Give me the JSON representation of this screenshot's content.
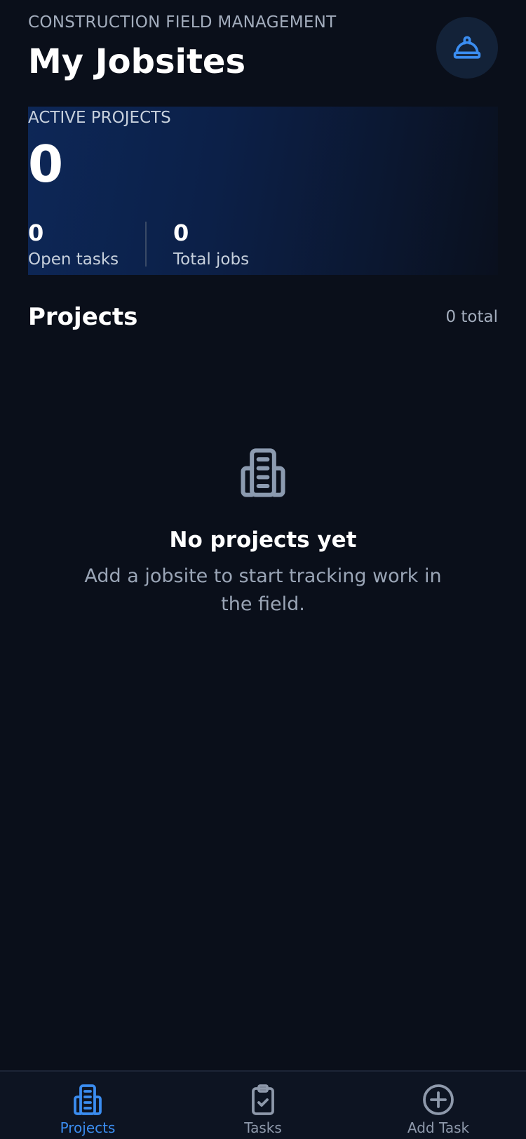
{
  "header": {
    "eyebrow": "CONSTRUCTION FIELD MANAGEMENT",
    "title": "My Jobsites",
    "profile_icon": "hard-hat-icon"
  },
  "stats": {
    "label": "ACTIVE PROJECTS",
    "active_count": "0",
    "open_tasks_value": "0",
    "open_tasks_label": "Open tasks",
    "total_jobs_value": "0",
    "total_jobs_label": "Total jobs"
  },
  "projects": {
    "title": "Projects",
    "count_text": "0 total"
  },
  "empty_state": {
    "icon": "building-icon",
    "title": "No projects yet",
    "message": "Add a jobsite to start tracking work in the field."
  },
  "tabbar": {
    "items": [
      {
        "label": "Projects",
        "icon": "building-icon",
        "active": true
      },
      {
        "label": "Tasks",
        "icon": "clipboard-check-icon",
        "active": false
      },
      {
        "label": "Add Task",
        "icon": "plus-circle-icon",
        "active": false
      }
    ]
  },
  "colors": {
    "background": "#0a0f1a",
    "accent": "#3b8df0",
    "muted_text": "#a3adbd"
  }
}
